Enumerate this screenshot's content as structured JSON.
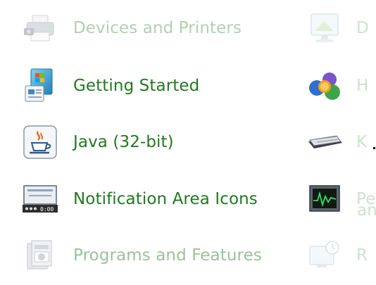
{
  "left_items": [
    {
      "label": "Devices and Printers",
      "icon": "printer-camera-icon"
    },
    {
      "label": "Getting Started",
      "icon": "getting-started-icon"
    },
    {
      "label": "Java (32-bit)",
      "icon": "java-cup-icon"
    },
    {
      "label": "Notification Area Icons",
      "icon": "taskbar-notification-icon"
    },
    {
      "label": "Programs and Features",
      "icon": "programs-features-icon"
    }
  ],
  "right_items": [
    {
      "label": "D",
      "icon": "display-icon"
    },
    {
      "label": "H",
      "icon": "homegroup-icon"
    },
    {
      "label": "K",
      "icon": "keyboard-icon"
    },
    {
      "label": "Pe",
      "label2": "an",
      "icon": "performance-monitor-icon"
    },
    {
      "label": "R",
      "icon": "recovery-icon"
    }
  ],
  "colors": {
    "link_green": "#1f7a1f",
    "background": "#ffffff"
  }
}
